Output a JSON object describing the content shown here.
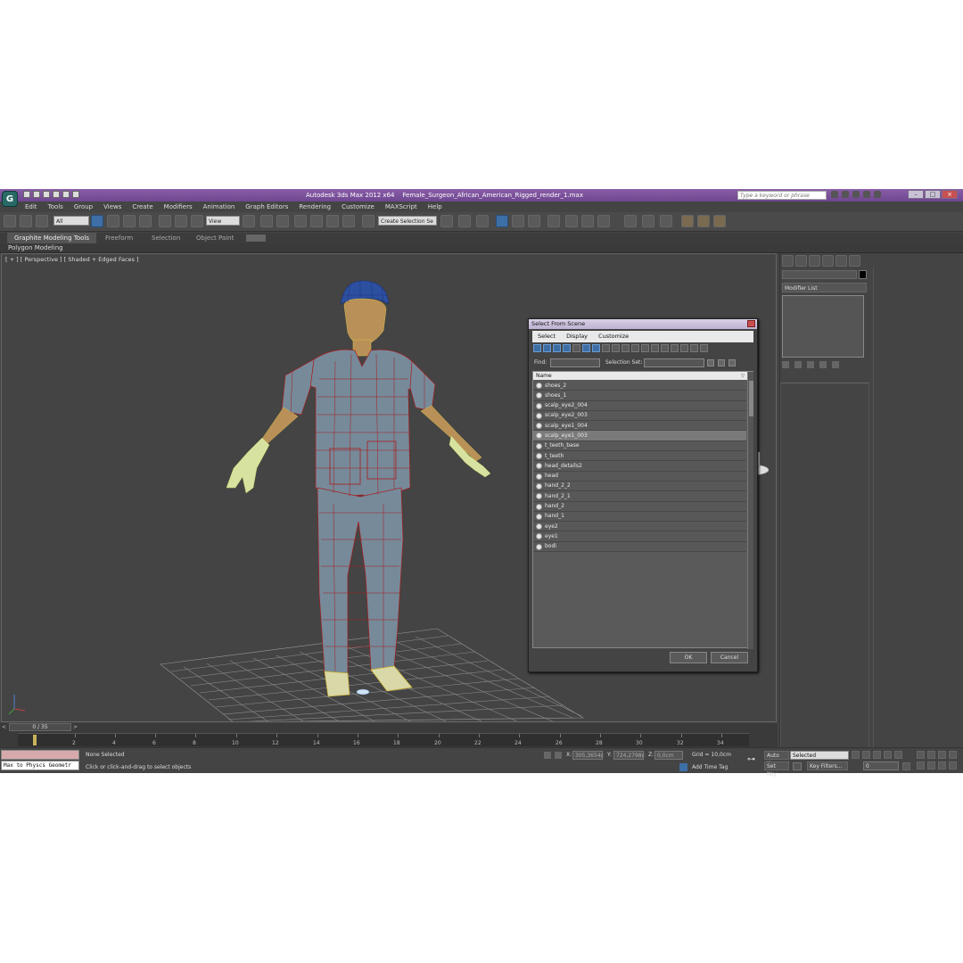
{
  "window": {
    "app_title": "Autodesk 3ds Max  2012 x64",
    "file_title": "Female_Surgeon_African_American_Rigged_render_1.max"
  },
  "logo_letter": "G",
  "search": {
    "placeholder": "Type a keyword or phrase"
  },
  "menu": [
    "Edit",
    "Tools",
    "Group",
    "Views",
    "Create",
    "Modifiers",
    "Animation",
    "Graph Editors",
    "Rendering",
    "Customize",
    "MAXScript",
    "Help"
  ],
  "toolbar": {
    "filter_value": "All",
    "refcoord_value": "View",
    "named_selection": "Create Selection Se"
  },
  "ribbon": {
    "tabs": [
      "Graphite Modeling Tools",
      "Freeform",
      "Selection",
      "Object Paint"
    ],
    "panel_label": "Polygon Modeling"
  },
  "viewport": {
    "label": "[ + ] [ Perspective ] [ Shaded + Edged Faces ]"
  },
  "command_panel": {
    "modifier_list": "Modifier List"
  },
  "dialog": {
    "title": "Select From Scene",
    "menu": [
      "Select",
      "Display",
      "Customize"
    ],
    "find_label": "Find:",
    "selection_set_label": "Selection Set:",
    "column_header": "Name",
    "items": [
      "shoes_2",
      "shoes_1",
      "scalp_eye2_004",
      "scalp_eye2_003",
      "scalp_eye1_004",
      "scalp_eye1_003",
      "t_teeth_base",
      "t_teeth",
      "head_details2",
      "head",
      "hand_2_2",
      "hand_2_1",
      "hand_2",
      "hand_1",
      "eye2",
      "eye1",
      "bodi"
    ],
    "selected_index": 5,
    "ok_label": "OK",
    "cancel_label": "Cancel"
  },
  "timeline": {
    "slider_label": "0 / 35",
    "ticks": [
      "2",
      "4",
      "6",
      "8",
      "10",
      "12",
      "14",
      "16",
      "18",
      "20",
      "22",
      "24",
      "26",
      "28",
      "30",
      "32",
      "34"
    ]
  },
  "status": {
    "maxscript_text": "Max to Physcs Geometr",
    "selection_status": "None Selected",
    "prompt": "Click or click-and-drag to select objects",
    "x_label": "X:",
    "x_value": "305,3654c",
    "y_label": "Y:",
    "y_value": "724,2798c",
    "z_label": "Z:",
    "z_value": "0,0cm",
    "grid": "Grid = 10,0cm",
    "add_time_tag": "Add Time Tag",
    "auto_key": "Auto Key",
    "set_key": "Set Key",
    "selected_value": "Selected",
    "key_filters": "Key Filters...",
    "frame_value": "0"
  },
  "colors": {
    "title_bar": "#7b539c",
    "viewport_bg": "#444444",
    "wireframe": "#b01818",
    "selection_blue": "#3d6ea6"
  }
}
